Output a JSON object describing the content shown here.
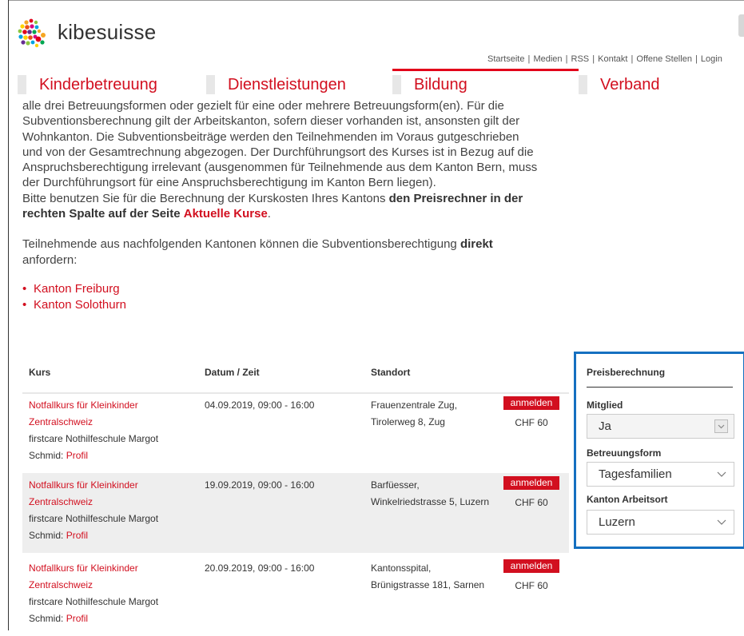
{
  "header": {
    "brand": "kibesuisse",
    "links": [
      "Startseite",
      "Medien",
      "RSS",
      "Kontakt",
      "Offene Stellen",
      "Login"
    ]
  },
  "nav": {
    "items": [
      "Kinderbetreuung",
      "Dienstleistungen",
      "Bildung",
      "Verband"
    ],
    "active": "Bildung"
  },
  "content": {
    "para1_lines": [
      "alle drei Betreuungsformen oder gezielt für eine oder mehrere Betreuungsform(en). Für die",
      "Subventionsberechnung gilt der Arbeitskanton, sofern dieser vorhanden ist, ansonsten gilt der",
      "Wohnkanton. Die Subventionsbeiträge werden den Teilnehmenden im Voraus gutgeschrieben",
      "und von der Gesamtrechnung abgezogen. Der Durchführungsort des Kurses ist in Bezug auf die",
      "Anspruchsberechtigung irrelevant (ausgenommen für Teilnehmende aus dem Kanton Bern, muss",
      "der Durchführungsort für eine Anspruchsberechtigung im Kanton Bern liegen)."
    ],
    "para1_tail_a": "Bitte benutzen Sie für die Berechnung der Kurskosten Ihres Kantons ",
    "para1_bold": "den Preisrechner in der rechten Spalte auf der Seite",
    "para1_link": "Aktuelle Kurse",
    "para1_end": ".",
    "para2_a": "Teilnehmende aus nachfolgenden Kantonen können die Subventionsberechtigung ",
    "para2_bold": "direkt",
    "para2_b": "anfordern:",
    "bullet_links": [
      "Kanton Freiburg",
      "Kanton Solothurn"
    ]
  },
  "table": {
    "headers": [
      "Kurs",
      "Datum / Zeit",
      "Standort"
    ],
    "rows": [
      {
        "kurs": "Notfallkurs für Kleinkinder Zentralschweiz",
        "provider": "firstcare Nothilfeschule Margot Schmid:",
        "profil": "Profil",
        "datum": "04.09.2019, 09:00 - 16:00",
        "standort": "Frauenzentrale Zug, Tirolerweg 8, Zug",
        "button": "anmelden",
        "price": "CHF 60"
      },
      {
        "kurs": "Notfallkurs für Kleinkinder Zentralschweiz",
        "provider": "firstcare Nothilfeschule Margot Schmid:",
        "profil": "Profil",
        "datum": "19.09.2019, 09:00 - 16:00",
        "standort": "Barfüesser, Winkelriedstrasse 5, Luzern",
        "button": "anmelden",
        "price": "CHF 60"
      },
      {
        "kurs": "Notfallkurs für Kleinkinder Zentralschweiz",
        "provider": "firstcare Nothilfeschule Margot Schmid:",
        "profil": "Profil",
        "datum": "20.09.2019, 09:00 - 16:00",
        "standort": "Kantonsspital, Brünigstrasse 181, Sarnen",
        "button": "anmelden",
        "price": "CHF 60"
      }
    ]
  },
  "panel": {
    "title": "Preisberechnung",
    "mitglied_label": "Mitglied",
    "mitglied_value": "Ja",
    "betreuungsform_label": "Betreuungsform",
    "betreuungsform_value": "Tagesfamilien",
    "kanton_label": "Kanton Arbeitsort",
    "kanton_value": "Luzern"
  },
  "colors": {
    "accent": "#d20f1f",
    "panel_border": "#1570c0"
  }
}
